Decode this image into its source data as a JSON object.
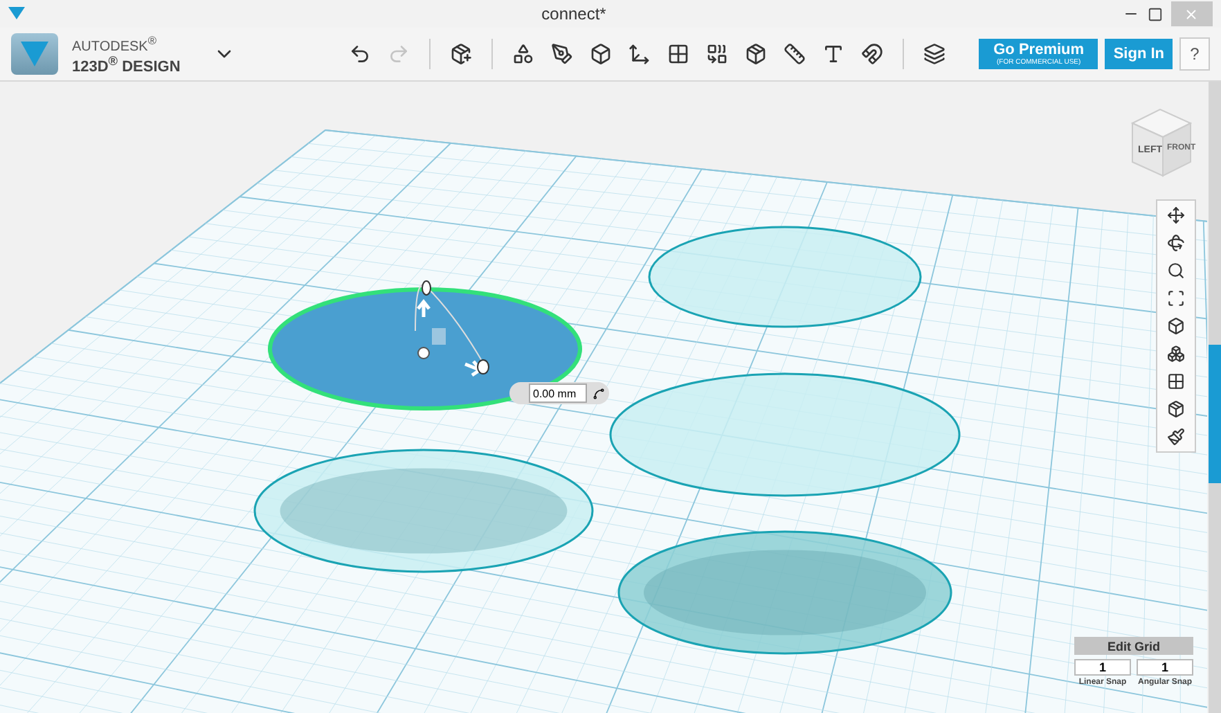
{
  "window": {
    "title": "connect*"
  },
  "brand": {
    "company": "AUTODESK$^{®}$",
    "product": "123D$^{®}$ DESIGN"
  },
  "history": {
    "undo": {
      "disabled": false
    },
    "redo": {
      "disabled": true
    }
  },
  "account": {
    "premium": {
      "label": "Go Premium",
      "sublabel": "(FOR COMMERCIAL USE)"
    },
    "sign_in": "Sign In",
    "help": "?"
  },
  "view_cube": {
    "faces": [
      "LEFT",
      "FRONT"
    ]
  },
  "shapes": [
    {
      "selected": true,
      "shadow": false
    },
    {
      "selected": false,
      "shadow": false
    },
    {
      "selected": false,
      "shadow": false
    },
    {
      "selected": false,
      "shadow": true
    },
    {
      "selected": false,
      "shadow": true
    }
  ],
  "dimension_input": {
    "value": "0.00 mm"
  },
  "grid_panel": {
    "title": "Edit Grid",
    "fields": [
      {
        "value": "1",
        "label": "Linear Snap"
      },
      {
        "value": "1",
        "label": "Angular Snap"
      }
    ]
  }
}
